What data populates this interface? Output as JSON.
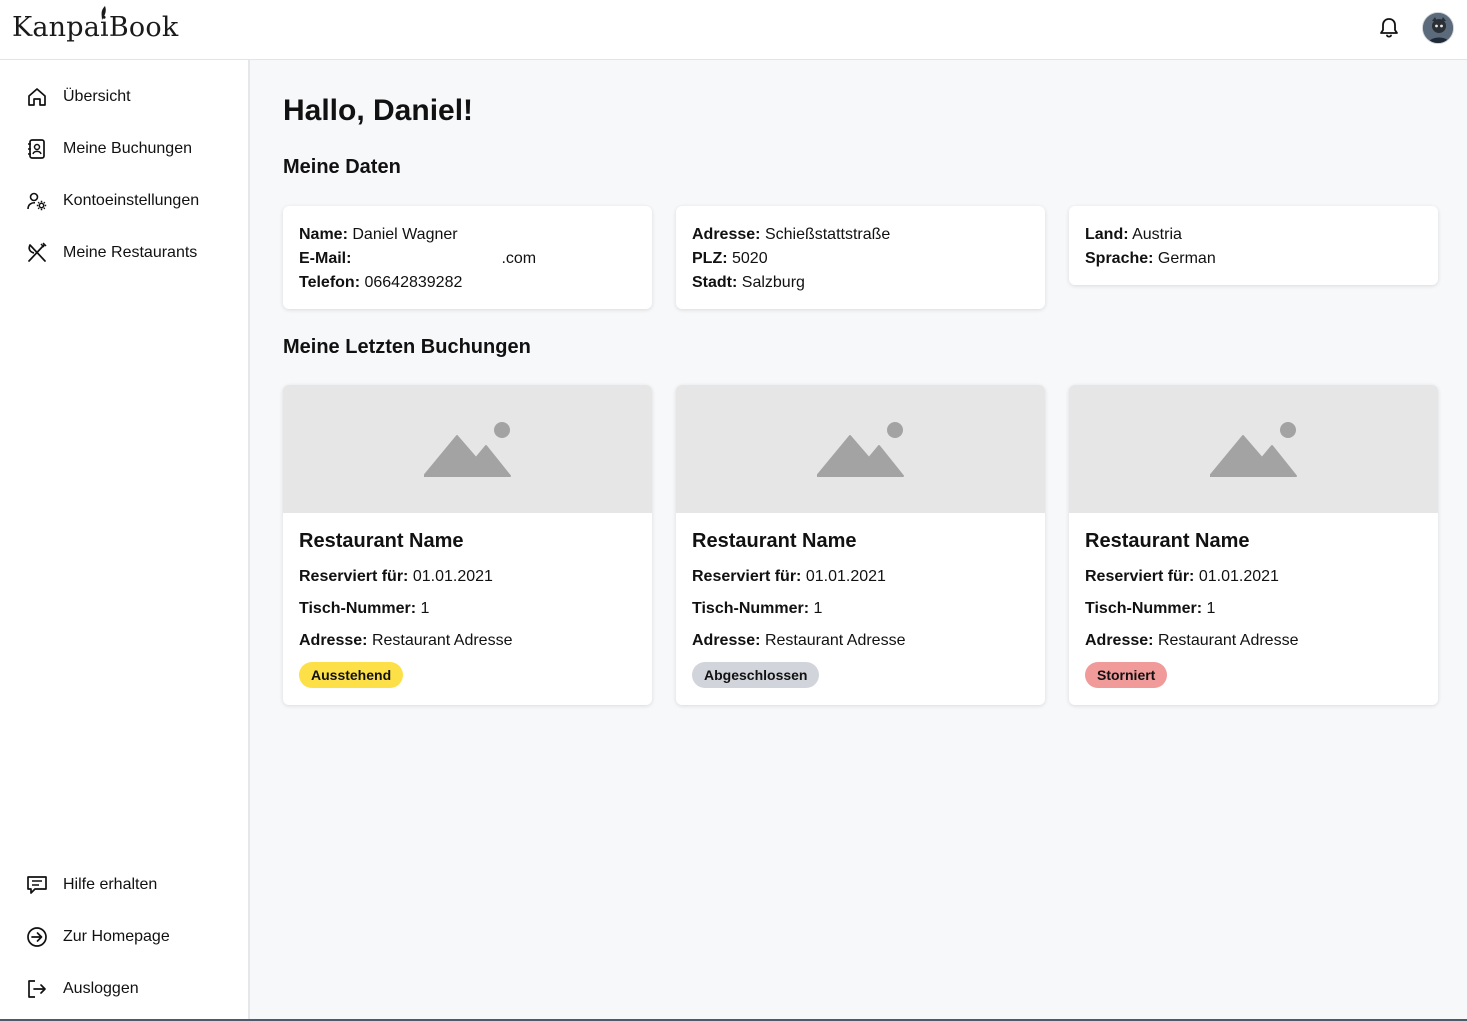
{
  "app": {
    "logo_text": "KanpaiBook"
  },
  "sidebar": {
    "items": [
      {
        "label": "Übersicht",
        "icon": "home-icon"
      },
      {
        "label": "Meine Buchungen",
        "icon": "contact-book-icon"
      },
      {
        "label": "Kontoeinstellungen",
        "icon": "user-settings-icon"
      },
      {
        "label": "Meine Restaurants",
        "icon": "utensils-icon"
      }
    ],
    "bottom_items": [
      {
        "label": "Hilfe erhalten",
        "icon": "chat-help-icon"
      },
      {
        "label": "Zur Homepage",
        "icon": "arrow-circle-right-icon"
      },
      {
        "label": "Ausloggen",
        "icon": "logout-icon"
      }
    ]
  },
  "main": {
    "greeting": "Hallo, Daniel!",
    "my_data_title": "Meine Daten",
    "personal": {
      "name_label": "Name:",
      "name": "Daniel Wagner",
      "email_label": "E-Mail:",
      "email_visible": ".com",
      "phone_label": "Telefon:",
      "phone": "06642839282"
    },
    "address": {
      "street_label": "Adresse:",
      "street": "Schießstattstraße",
      "zip_label": "PLZ:",
      "zip": "5020",
      "city_label": "Stadt:",
      "city": "Salzburg"
    },
    "locale": {
      "country_label": "Land:",
      "country": "Austria",
      "language_label": "Sprache:",
      "language": "German"
    },
    "recent_title": "Meine Letzten Buchungen",
    "bookings": [
      {
        "name": "Restaurant Name",
        "reserved_label": "Reserviert für:",
        "reserved": "01.01.2021",
        "table_label": "Tisch-Nummer:",
        "table": "1",
        "address_label": "Adresse:",
        "address": "Restaurant Adresse",
        "status": "Ausstehend",
        "status_color": "#fde047"
      },
      {
        "name": "Restaurant Name",
        "reserved_label": "Reserviert für:",
        "reserved": "01.01.2021",
        "table_label": "Tisch-Nummer:",
        "table": "1",
        "address_label": "Adresse:",
        "address": "Restaurant Adresse",
        "status": "Abgeschlossen",
        "status_color": "#d1d5db"
      },
      {
        "name": "Restaurant Name",
        "reserved_label": "Reserviert für:",
        "reserved": "01.01.2021",
        "table_label": "Tisch-Nummer:",
        "table": "1",
        "address_label": "Adresse:",
        "address": "Restaurant Adresse",
        "status": "Storniert",
        "status_color": "#f09a9a"
      }
    ]
  }
}
